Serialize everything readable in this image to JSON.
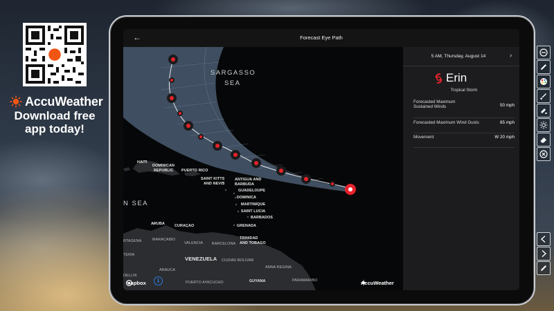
{
  "promo": {
    "brand_name": "AccuWeather",
    "line1": "Download free",
    "line2": "app today!",
    "brand_color": "#f05514"
  },
  "screen": {
    "title": "Forecast Eye Path",
    "back_icon": "arrow-left-icon"
  },
  "map": {
    "sea_labels": {
      "sargasso_1": "SARGASSO",
      "sargasso_2": "SEA",
      "caribbean": "N SEA"
    },
    "places": {
      "haiti": "HAITI",
      "dominican_1": "DOMINICAN",
      "dominican_2": "REPUBLIC",
      "puerto_rico": "PUERTO RICO",
      "st_kitts_1": "SAINT KITTS",
      "st_kitts_2": "AND NEVIS",
      "antigua_1": "ANTIGUA AND",
      "antigua_2": "BARBUDA",
      "guadeloupe": "GUADELOUPE",
      "dominica": "DOMINICA",
      "martinique": "MARTINIQUE",
      "saint_lucia": "SAINT LUCIA",
      "barbados": "BARBADOS",
      "aruba": "ARUBA",
      "curacao": "CURAÇAO",
      "grenada": "GRENADA",
      "trinidad_1": "TRINIDAD",
      "trinidad_2": "AND TOBAGO",
      "cartagena": "RTAGENA",
      "maracaibo": "MARACAIBO",
      "valencia": "VALENCIA",
      "barcelona": "BARCELONA",
      "monteria": "TERIA",
      "venezuela": "VENEZUELA",
      "ciudad_bolivar": "CIUDAD BOLIVAR",
      "anna_regina": "ANNA REGINA",
      "medellin": "DELLIN",
      "arauca": "ARAUCA",
      "puerto_ayacucho": "PUERTO AYACUCHO",
      "guyana": "GUYANA",
      "paramaribo": "PARAMARIBO"
    },
    "attribution": "mapbox",
    "watermark": "AccuWeather",
    "track_color": "#e8222b",
    "cone_color": "#4a5a70"
  },
  "panel": {
    "date": "5 AM, Thursday, August 14",
    "storm_name": "Erin",
    "storm_type": "Tropical Storm",
    "rows": [
      {
        "label_1": "Forecasted Maximum",
        "label_2": "Sustained Winds",
        "value": "50 mph"
      },
      {
        "label": "Forecasted Maximum Wind Gusts",
        "value": "65 mph"
      },
      {
        "label": "Movement",
        "value": "W 20 mph"
      }
    ]
  },
  "toolbar": {
    "tools": [
      "minus-circle-icon",
      "pencil-icon",
      "color-palette-icon",
      "brush-icon",
      "highlighter-icon",
      "brightness-icon",
      "eraser-icon",
      "close-circle-icon",
      "chevron-left-icon",
      "chevron-right-icon",
      "pencil-icon"
    ]
  }
}
